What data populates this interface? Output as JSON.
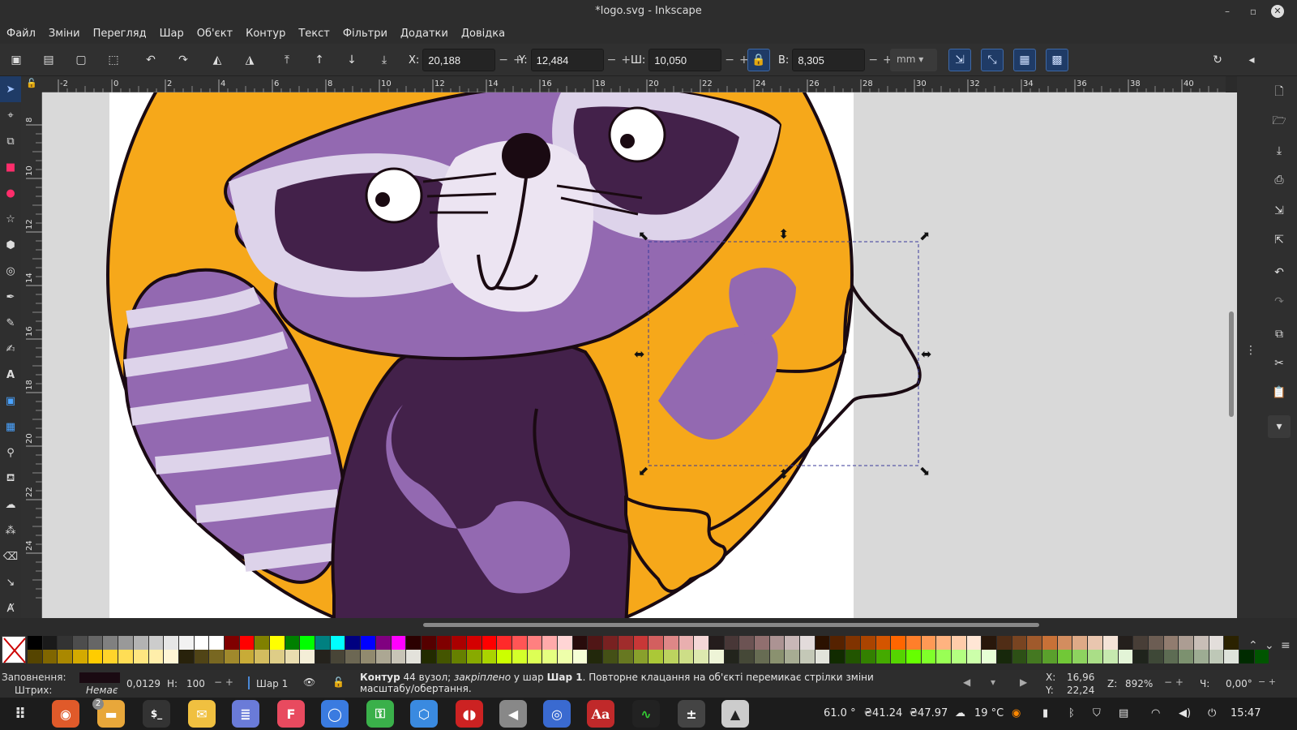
{
  "window": {
    "title": "*logo.svg - Inkscape"
  },
  "menu": [
    "Файл",
    "Зміни",
    "Перегляд",
    "Шар",
    "Об'єкт",
    "Контур",
    "Текст",
    "Фільтри",
    "Додатки",
    "Довідка"
  ],
  "toolbar": {
    "x_label": "X:",
    "x_value": "20,188",
    "y_label": "Y:",
    "y_value": "12,484",
    "w_label": "Ш:",
    "w_value": "10,050",
    "h_label": "В:",
    "h_value": "8,305",
    "unit": "mm"
  },
  "ruler": {
    "h_ticks": [
      "-2",
      "0",
      "2",
      "4",
      "6",
      "8",
      "10",
      "12",
      "14",
      "16",
      "18",
      "20",
      "22",
      "24",
      "26",
      "28",
      "30",
      "32",
      "34",
      "36",
      "38",
      "40"
    ],
    "v_ticks": [
      "8",
      "10",
      "12",
      "14",
      "16",
      "18",
      "20",
      "22",
      "24"
    ]
  },
  "palette": {
    "row1": [
      "#000000",
      "#1a1a1a",
      "#333333",
      "#4d4d4d",
      "#666666",
      "#808080",
      "#999999",
      "#b3b3b3",
      "#cccccc",
      "#e6e6e6",
      "#f2f2f2",
      "#ffffff",
      "#ffffff",
      "#800000",
      "#ff0000",
      "#808000",
      "#ffff00",
      "#008000",
      "#00ff00",
      "#008080",
      "#00ffff",
      "#000080",
      "#0000ff",
      "#800080",
      "#ff00ff",
      "#2b0000",
      "#550000",
      "#800000",
      "#aa0000",
      "#d40000",
      "#ff0000",
      "#ff2a2a",
      "#ff5555",
      "#ff8080",
      "#ffaaaa",
      "#ffd5d5",
      "#280b0b",
      "#501616",
      "#782121",
      "#a02c2c",
      "#c83737",
      "#d35f5f",
      "#de8787",
      "#e9afaf",
      "#f4d7d7",
      "#241c1c",
      "#483737",
      "#6c5353",
      "#916f6f",
      "#ac9393",
      "#c8b7b7",
      "#e3dbdb",
      "#2b1100",
      "#552200",
      "#803300",
      "#aa4400",
      "#d45500",
      "#ff6600",
      "#ff7f2a",
      "#ff9955",
      "#ffb380",
      "#ffccaa",
      "#ffe6d5",
      "#28170b",
      "#502d16",
      "#784421",
      "#a05a2c",
      "#c87137",
      "#d38d5f",
      "#deaa87",
      "#e9c6af",
      "#f4e3d7",
      "#241f1c",
      "#483e37",
      "#6c5d53",
      "#917c6f",
      "#ac9d93",
      "#c8beb7",
      "#e3dedb",
      "#2b2200"
    ],
    "row2": [
      "#554400",
      "#806600",
      "#aa8800",
      "#d4aa00",
      "#ffcc00",
      "#ffd42a",
      "#ffdd55",
      "#ffe680",
      "#ffeeaa",
      "#fff6d5",
      "#28220b",
      "#504416",
      "#786721",
      "#a0892c",
      "#c8ab37",
      "#d3bc5f",
      "#decd87",
      "#e9ddaf",
      "#f4eed7",
      "#24221c",
      "#484537",
      "#6c6753",
      "#918a6f",
      "#aca793",
      "#c8c4b7",
      "#e3e2db",
      "#222b00",
      "#445500",
      "#668000",
      "#88aa00",
      "#aad400",
      "#ccff00",
      "#d4ff2a",
      "#ddff55",
      "#e5ff80",
      "#eeffaa",
      "#f6ffd5",
      "#22280b",
      "#445016",
      "#677821",
      "#89a02c",
      "#abc837",
      "#bcd35f",
      "#cdde87",
      "#dde9af",
      "#eef4d7",
      "#22241c",
      "#454837",
      "#676c53",
      "#8a916f",
      "#a7ac93",
      "#c4c8b7",
      "#e2e3db",
      "#112b00",
      "#225500",
      "#338000",
      "#44aa00",
      "#55d400",
      "#66ff00",
      "#7fff2a",
      "#99ff55",
      "#b3ff80",
      "#ccffaa",
      "#e6ffd5",
      "#17280b",
      "#2d5016",
      "#447821",
      "#5aa02c",
      "#71c837",
      "#8dd35f",
      "#aade87",
      "#c6e9af",
      "#e3f4d7",
      "#1f241c",
      "#3e4837",
      "#5d6c53",
      "#7c916f",
      "#9dac93",
      "#bec8b7",
      "#dee3db",
      "#002b00",
      "#005500"
    ]
  },
  "status": {
    "fill_label": "Заповнення:",
    "fill_value": "",
    "stroke_label": "Штрих:",
    "stroke_value": "Немає",
    "stroke_width": "0,0129",
    "opacity_label": "Н:",
    "opacity_value": "100",
    "layer": "Шар 1",
    "message_bold": "Контур",
    "message_mid": " 44 вузол; ",
    "message_em": "закріплено",
    "message_mid2": " у шар ",
    "message_bold2": "Шар 1",
    "message_tail": ". Повторне клацання на об'єкті перемикає стрілки зміни масштабу/обертання.",
    "cursor_x_label": "X:",
    "cursor_x": "16,96",
    "cursor_y_label": "Y:",
    "cursor_y": "22,24",
    "zoom_label": "Z:",
    "zoom": "892%",
    "rotation_label": "Ч:",
    "rotation": "0,00°"
  },
  "taskbar": {
    "badge": "2",
    "cpu_temp": "61.0 °",
    "price1": "₴41.24",
    "price2": "₴47.97",
    "weather": "19 °C",
    "time": "15:47"
  },
  "colors": {
    "orange": "#f6a81a",
    "purple_light": "#9369b1",
    "purple_dark": "#43214a",
    "lavender": "#ddd3ea",
    "selection": "#3a3a9a"
  }
}
